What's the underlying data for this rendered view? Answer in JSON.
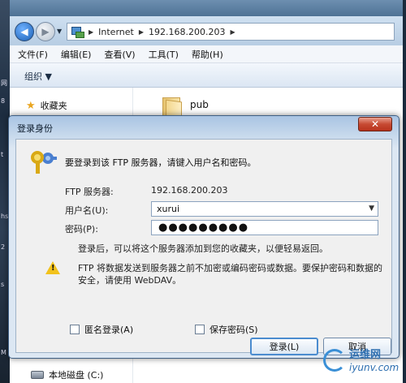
{
  "breadcrumb": [
    "Internet",
    "192.168.200.203"
  ],
  "menu": [
    "文件(F)",
    "编辑(E)",
    "查看(V)",
    "工具(T)",
    "帮助(H)"
  ],
  "toolbar": {
    "organize": "组织 ▼"
  },
  "nav": {
    "favorites": "收藏夹",
    "local_disk": "本地磁盘 (C:)"
  },
  "content": {
    "folder": "pub"
  },
  "dialog": {
    "title": "登录身份",
    "close_glyph": "✕",
    "intro": "要登录到该 FTP 服务器，请键入用户名和密码。",
    "server_label": "FTP 服务器:",
    "server_value": "192.168.200.203",
    "user_label": "用户名(U):",
    "user_value": "xurui",
    "password_label": "密码(P):",
    "password_value": "●●●●●●●●●",
    "note": "登录后，可以将这个服务器添加到您的收藏夹，以便轻易返回。",
    "warning": "FTP 将数据发送到服务器之前不加密或编码密码或数据。要保护密码和数据的安全，请使用 WebDAV。",
    "anonymous_label": "匿名登录(A)",
    "save_password_label": "保存密码(S)",
    "login_button": "登录(L)",
    "cancel_button": "取消"
  },
  "watermark": {
    "cn": "运维网",
    "en": "iyunv.com"
  },
  "desktop_fragments": [
    "网",
    "8",
    "t",
    "hs",
    "2",
    "s",
    "M"
  ]
}
